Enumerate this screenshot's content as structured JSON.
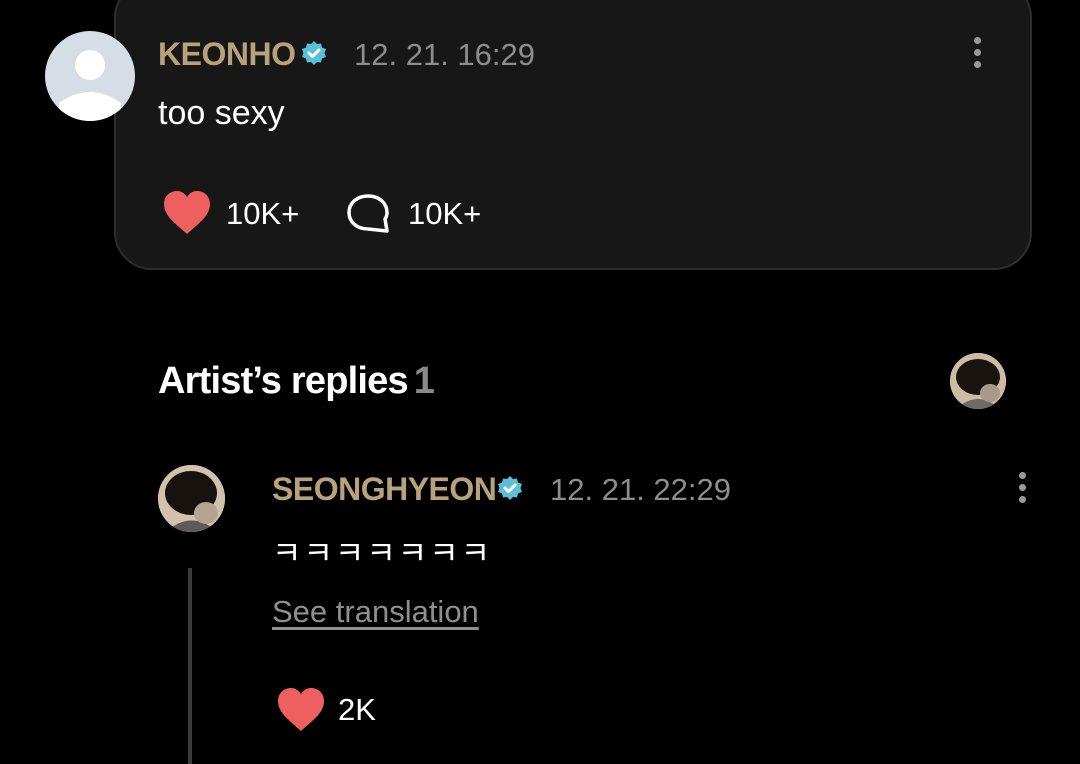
{
  "comment": {
    "username": "KEONHO",
    "timestamp": "12. 21. 16:29",
    "text": "too sexy",
    "likes": "10K+",
    "replies": "10K+"
  },
  "artist_replies": {
    "title": "Artist’s replies",
    "count": "1"
  },
  "reply": {
    "username": "SEONGHYEON",
    "timestamp": "12. 21. 22:29",
    "text": "ㅋㅋㅋㅋㅋㅋㅋ",
    "translate_label": "See translation",
    "likes": "2K"
  },
  "colors": {
    "background": "#000000",
    "card": "#171717",
    "username": "#b8a17d",
    "verified": "#5bc0d6",
    "heart": "#ee5f5f",
    "muted": "#8d8d8d"
  }
}
